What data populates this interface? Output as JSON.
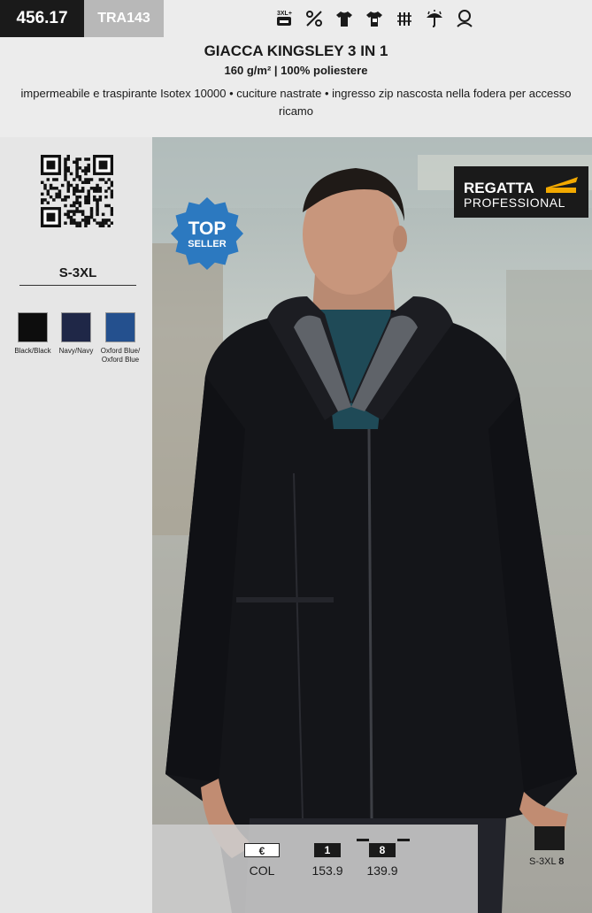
{
  "header": {
    "code": "456.17",
    "ref": "TRA143",
    "icons": [
      "size-extended-icon",
      "tape-seams-icon",
      "tshirt-icon",
      "embroidery-icon",
      "breathable-icon",
      "waterproof-icon",
      "hood-icon"
    ],
    "size_icon_text": "3XL+"
  },
  "product": {
    "title": "GIACCA KINGSLEY 3 IN 1",
    "subtitle": "160 g/m² | 100% poliestere",
    "description": "impermeabile e traspirante Isotex 10000 • cuciture nastrate • ingresso zip nascosta nella fodera per accesso ricamo"
  },
  "sidebar": {
    "sizes": "S-3XL",
    "colors": [
      {
        "label": "Black/Black",
        "hex": "#0d0d0d"
      },
      {
        "label": "Navy/Navy",
        "hex": "#1f2747"
      },
      {
        "label": "Oxford Blue/ Oxford Blue",
        "hex": "#24508e"
      }
    ]
  },
  "badge": {
    "line1": "TOP",
    "line2": "SELLER",
    "color": "#2c79c0"
  },
  "brand": {
    "line1": "REGATTA",
    "line2": "PROFESSIONAL",
    "accent": "#f2a900"
  },
  "price": {
    "currency": "€",
    "col_label": "COL",
    "qty_1": "1",
    "price_1": "153.9",
    "qty_8": "8",
    "price_8": "139.9"
  },
  "pack": {
    "sizes": "S-3XL",
    "qty": "8"
  }
}
